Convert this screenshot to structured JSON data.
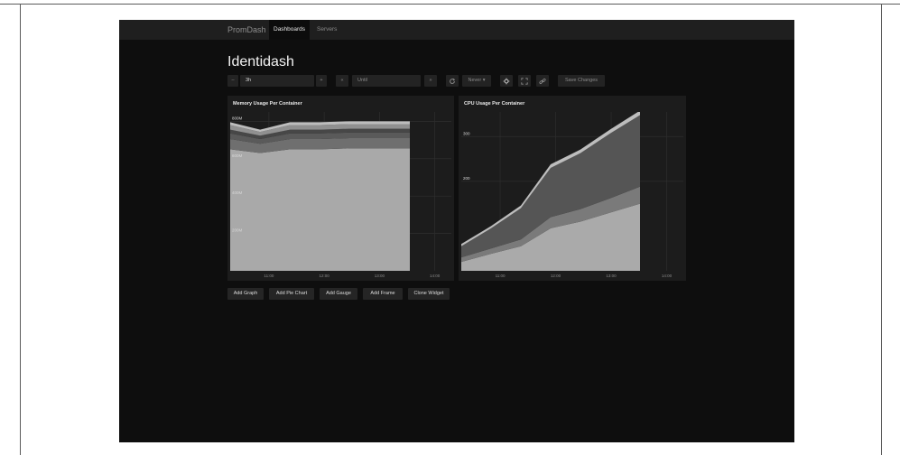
{
  "app": {
    "brand": "PromDash"
  },
  "nav": {
    "tabs": [
      "Dashboards",
      "Servers"
    ],
    "active": "Dashboards"
  },
  "dashboard": {
    "title": "Identidash"
  },
  "toolbar": {
    "zoom_out": "–",
    "range_value": "3h",
    "zoom_in": "+",
    "back": "«",
    "until_placeholder": "Until",
    "forward": "»",
    "refresh_icon": "refresh-icon",
    "refresh_interval": "Never ▾",
    "settings_icon": "gear-icon",
    "fullscreen_icon": "expand-icon",
    "link_icon": "link-icon",
    "save": "Save Changes"
  },
  "colors": {
    "app_bg": "#0e0e0e",
    "panel_bg": "#1c1c1c",
    "area_light": "#a9a9a9",
    "area_mid": "#656565",
    "area_dark": "#4c4c4c",
    "area_top": "#c9c9c9"
  },
  "widgets": [
    {
      "title": "Memory Usage Per Container"
    },
    {
      "title": "CPU Usage Per Container"
    }
  ],
  "actions": {
    "add_graph": "Add Graph",
    "add_pie": "Add Pie Chart",
    "add_gauge": "Add Gauge",
    "add_frame": "Add Frame",
    "clone": "Clone Widget"
  },
  "chart_data": [
    {
      "type": "area",
      "title": "Memory Usage Per Container",
      "stacked": true,
      "x": [
        "11:00",
        "11:30",
        "12:00",
        "12:30",
        "13:00",
        "13:30",
        "14:00"
      ],
      "x_ticks": [
        "11:00",
        "12:00",
        "13:00",
        "14:00"
      ],
      "y_ticks": [
        "200M",
        "400M",
        "600M",
        "800M"
      ],
      "ylim": [
        0,
        850
      ],
      "series": [
        {
          "values": [
            650,
            630,
            650,
            650,
            655,
            655,
            655
          ],
          "color": "#a9a9a9"
        },
        {
          "values": [
            55,
            50,
            55,
            55,
            55,
            55,
            55
          ],
          "color": "#6f6f6f"
        },
        {
          "values": [
            30,
            25,
            30,
            30,
            30,
            30,
            30
          ],
          "color": "#5a5a5a"
        },
        {
          "values": [
            20,
            18,
            20,
            20,
            20,
            20,
            20
          ],
          "color": "#474747"
        },
        {
          "values": [
            25,
            20,
            25,
            25,
            25,
            25,
            25
          ],
          "color": "#909090"
        },
        {
          "values": [
            15,
            12,
            15,
            15,
            15,
            15,
            15
          ],
          "color": "#bdbdbd"
        }
      ],
      "grid": true
    },
    {
      "type": "area",
      "title": "CPU Usage Per Container",
      "stacked": true,
      "x": [
        "11:00",
        "11:30",
        "12:00",
        "12:30",
        "13:00",
        "13:30",
        "14:00"
      ],
      "x_ticks": [
        "11:00",
        "12:00",
        "13:00",
        "14:00"
      ],
      "y_ticks": [
        "200",
        "300"
      ],
      "ylim": [
        0,
        355
      ],
      "series": [
        {
          "values": [
            20,
            38,
            55,
            95,
            110,
            130,
            150
          ],
          "color": "#aaaaaa"
        },
        {
          "values": [
            10,
            12,
            15,
            25,
            28,
            32,
            38
          ],
          "color": "#7a7a7a"
        },
        {
          "values": [
            25,
            45,
            70,
            110,
            125,
            145,
            160
          ],
          "color": "#555555"
        },
        {
          "values": [
            5,
            5,
            6,
            8,
            8,
            9,
            10
          ],
          "color": "#bdbdbd"
        }
      ],
      "grid": true
    }
  ]
}
